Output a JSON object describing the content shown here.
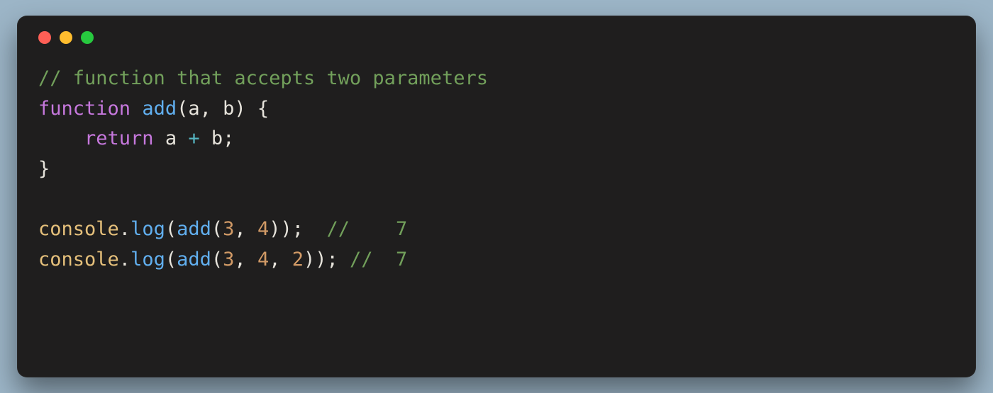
{
  "traffic_lights": {
    "red_color": "#ff5f56",
    "yellow_color": "#ffbd2e",
    "green_color": "#27c93f"
  },
  "code": {
    "line1": {
      "comment": "// function that accepts two parameters"
    },
    "line2": {
      "kw": "function",
      "space1": " ",
      "name": "add",
      "open": "(",
      "params": "a, b",
      "close": ") {"
    },
    "line3": {
      "indent": "    ",
      "kw": "return",
      "space1": " ",
      "expr_a": "a ",
      "op": "+",
      "expr_b": " b",
      "semi": ";"
    },
    "line4": {
      "brace": "}"
    },
    "line5": {
      "blank": ""
    },
    "line6": {
      "obj": "console",
      "dot": ".",
      "method": "log",
      "open": "(",
      "call": "add",
      "openc": "(",
      "n1": "3",
      "comma": ", ",
      "n2": "4",
      "closec": ")",
      "close": ");",
      "gap": "  ",
      "comment": "//    7"
    },
    "line7": {
      "obj": "console",
      "dot": ".",
      "method": "log",
      "open": "(",
      "call": "add",
      "openc": "(",
      "n1": "3",
      "comma1": ", ",
      "n2": "4",
      "comma2": ", ",
      "n3": "2",
      "closec": ")",
      "close": "); ",
      "comment": "//  7"
    }
  }
}
